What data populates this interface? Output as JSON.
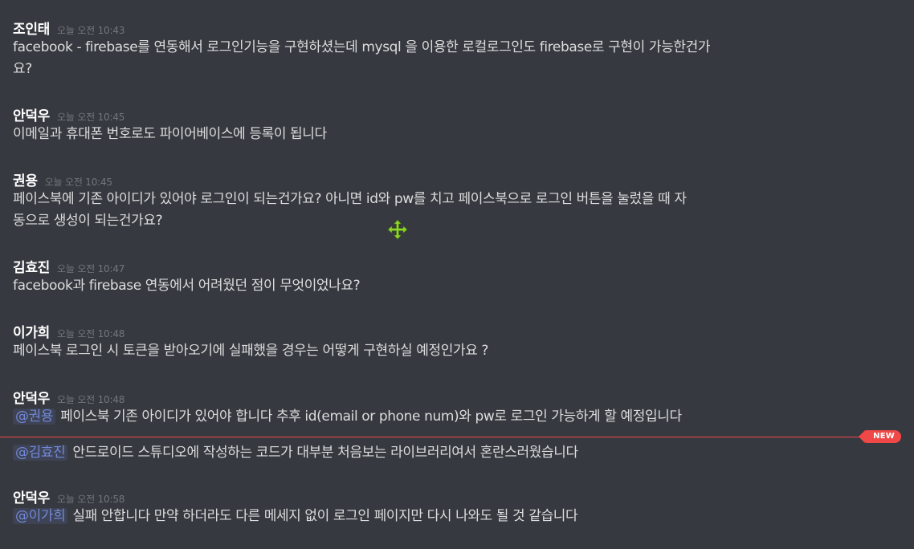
{
  "messages": [
    {
      "author": "조인태",
      "time": "오늘 오전 10:43",
      "lines": [
        "facebook - firebase를 연동해서 로그인기능을 구현하셨는데 mysql 을 이용한 로컬로그인도 firebase로 구현이 가능한건가",
        "요?"
      ]
    },
    {
      "author": "안덕우",
      "time": "오늘 오전 10:45",
      "lines": [
        "이메일과 휴대폰 번호로도 파이어베이스에 등록이 됩니다"
      ]
    },
    {
      "author": "권용",
      "time": "오늘 오전 10:45",
      "lines": [
        "페이스북에 기존 아이디가 있어야 로그인이 되는건가요? 아니면 id와 pw를 치고 페이스북으로 로그인 버튼을 눌렀을 때 자",
        "동으로 생성이 되는건가요?"
      ]
    },
    {
      "author": "김효진",
      "time": "오늘 오전 10:47",
      "lines": [
        "facebook과 firebase 연동에서 어려웠던 점이 무엇이었나요?"
      ]
    },
    {
      "author": "이가희",
      "time": "오늘 오전 10:48",
      "lines": [
        "페이스북 로그인 시 토큰을 받아오기에 실패했을 경우는 어떻게 구현하실 예정인가요 ?"
      ]
    },
    {
      "author": "안덕우",
      "time": "오늘 오전 10:48",
      "reply1": {
        "mention": "@권용",
        "text": "페이스북 기존 아이디가 있어야 합니다 추후 id(email or phone num)와 pw로 로그인 가능하게 할 예정입니다"
      },
      "reply2": {
        "mention": "@김효진",
        "text": "안드로이드 스튜디오에 작성하는 코드가 대부분 처음보는 라이브러리여서 혼란스러웠습니다"
      }
    },
    {
      "author": "안덕우",
      "time": "오늘 오전 10:58",
      "reply1": {
        "mention": "@이가희",
        "text": "실패 안합니다 만약 하더라도 다른 메세지 없이 로그인 페이지만 다시 나와도 될 것 같습니다"
      }
    }
  ],
  "divider": {
    "badge": "NEW",
    "color": "#f04747"
  },
  "colors": {
    "background": "#36393f",
    "text": "#dcddde",
    "mention": "#7289da",
    "cursor": "#8fd62c"
  },
  "cursor_icon": "move-cursor-icon"
}
